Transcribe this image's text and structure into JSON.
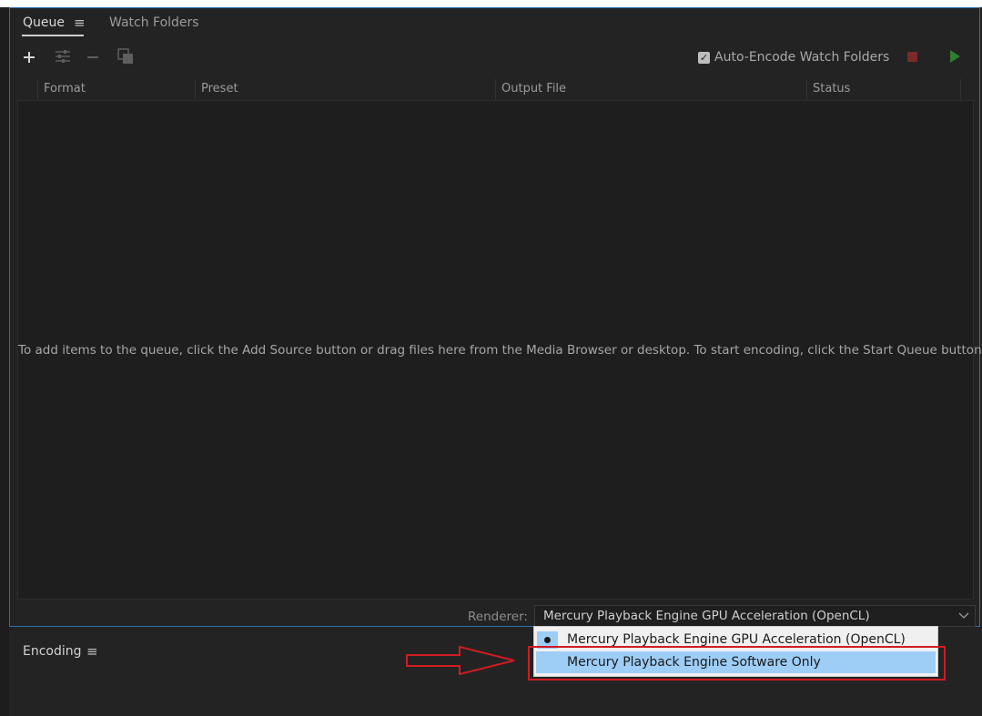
{
  "queue_panel": {
    "tabs": [
      {
        "label": "Queue",
        "active": true
      },
      {
        "label": "Watch Folders",
        "active": false
      }
    ],
    "menu_glyph": "≡",
    "toolbar": {
      "add_icon": "plus-icon",
      "settings_icon": "settings-sliders-icon",
      "remove_icon": "minus-icon",
      "duplicate_icon": "duplicate-icon",
      "auto_encode_label": "Auto-Encode Watch Folders",
      "auto_encode_checked": true,
      "stop_icon": "stop-icon",
      "start_icon": "play-icon"
    },
    "columns": [
      "Format",
      "Preset",
      "Output File",
      "Status"
    ],
    "empty_hint": "To add items to the queue, click the Add Source button or drag files here from the Media Browser or desktop.  To start encoding, click the Start Queue button.",
    "renderer": {
      "label": "Renderer:",
      "selected": "Mercury Playback Engine GPU Acceleration (OpenCL)",
      "options": [
        "Mercury Playback Engine GPU Acceleration (OpenCL)",
        "Mercury Playback Engine Software Only"
      ]
    }
  },
  "encoding_panel": {
    "title": "Encoding",
    "menu_glyph": "≡"
  },
  "colors": {
    "panel_bg": "#232323",
    "accent_border": "#2d6fae",
    "dropdown_highlight": "#9ecdf6",
    "annotation_red": "#d01c22",
    "stop_red": "#7a2a2a",
    "start_green": "#2f7d2f"
  }
}
